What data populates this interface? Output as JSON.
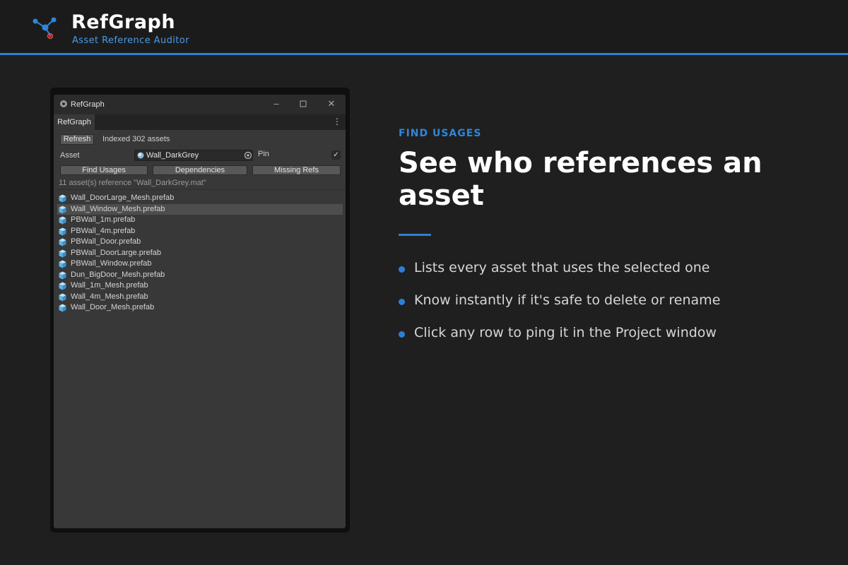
{
  "header": {
    "title": "RefGraph",
    "subtitle": "Asset Reference Auditor",
    "accent_color": "#2d7fd6"
  },
  "window": {
    "title": "RefGraph",
    "tab": "RefGraph",
    "refresh_label": "Refresh",
    "indexed_text": "Indexed 302 assets",
    "asset_label": "Asset",
    "asset_value": "Wall_DarkGrey",
    "pin_label": "Pin",
    "pin_checked": true,
    "modes": [
      "Find Usages",
      "Dependencies",
      "Missing Refs"
    ],
    "result_summary": "11 asset(s) reference \"Wall_DarkGrey.mat\"",
    "results": [
      "Wall_DoorLarge_Mesh.prefab",
      "Wall_Window_Mesh.prefab",
      "PBWall_1m.prefab",
      "PBWall_4m.prefab",
      "PBWall_Door.prefab",
      "PBWall_DoorLarge.prefab",
      "PBWall_Window.prefab",
      "Dun_BigDoor_Mesh.prefab",
      "Wall_1m_Mesh.prefab",
      "Wall_4m_Mesh.prefab",
      "Wall_Door_Mesh.prefab"
    ],
    "selected_index": 1
  },
  "promo": {
    "eyebrow": "FIND USAGES",
    "headline": "See who references an asset",
    "bullets": [
      "Lists every asset that uses the selected one",
      "Know instantly if it's safe to delete or rename",
      "Click any row to ping it in the Project window"
    ]
  }
}
